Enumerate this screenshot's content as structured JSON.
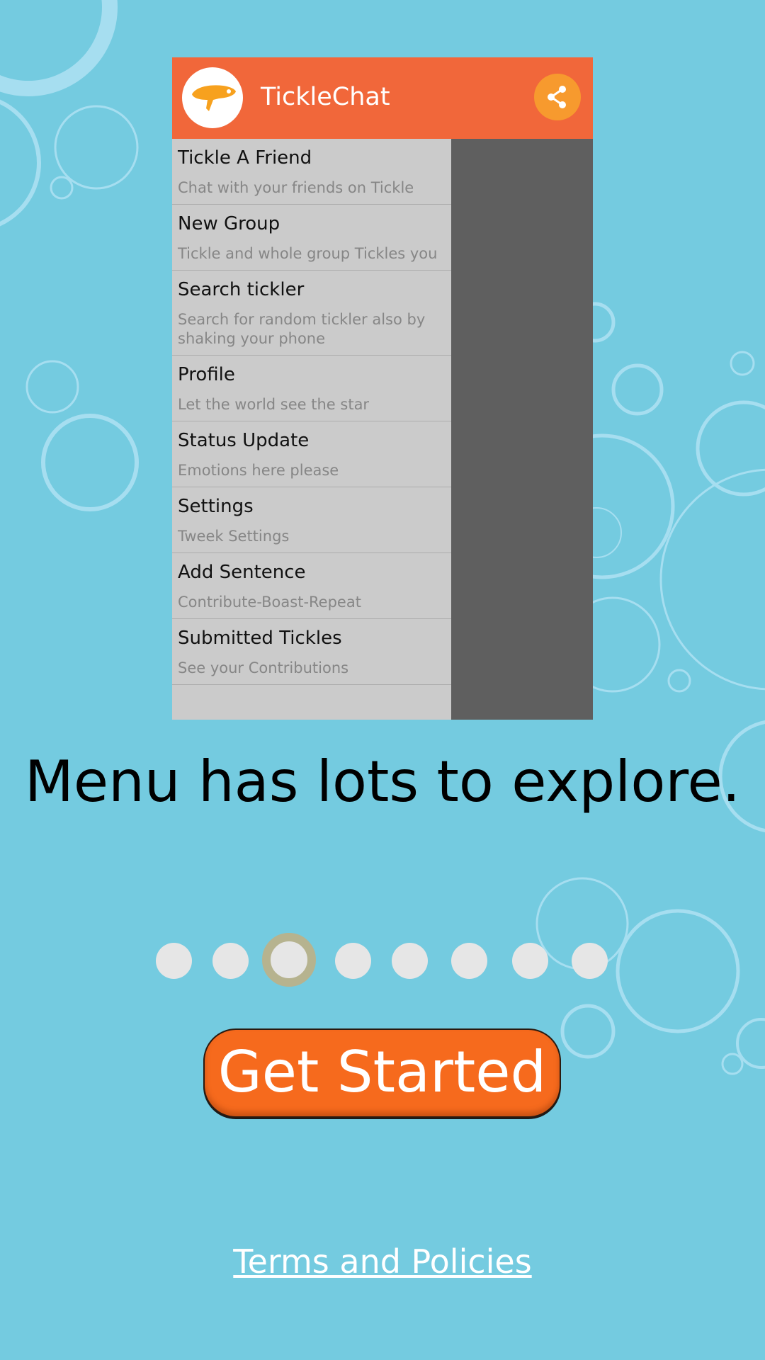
{
  "app": {
    "title": "TickleChat"
  },
  "menu": {
    "items": [
      {
        "title": "Tickle A Friend",
        "subtitle": "Chat with your friends on Tickle"
      },
      {
        "title": "New Group",
        "subtitle": "Tickle and whole group Tickles you"
      },
      {
        "title": "Search tickler",
        "subtitle": "Search for random tickler also by shaking your phone"
      },
      {
        "title": "Profile",
        "subtitle": "Let the world see the star"
      },
      {
        "title": "Status Update",
        "subtitle": "Emotions here please"
      },
      {
        "title": "Settings",
        "subtitle": "Tweek Settings"
      },
      {
        "title": "Add Sentence",
        "subtitle": "Contribute-Boast-Repeat"
      },
      {
        "title": "Submitted Tickles",
        "subtitle": "See your Contributions"
      }
    ]
  },
  "caption": {
    "text": "Menu has lots to explore."
  },
  "pager": {
    "total": 8,
    "current": 3
  },
  "cta": {
    "label": "Get Started"
  },
  "footer": {
    "terms_label": "Terms and Policies"
  },
  "colors": {
    "background": "#74cbe0",
    "header": "#f1673a",
    "button": "#f66a1d",
    "share": "#f79a2e"
  },
  "icons": {
    "logo": "tickle-feather-logo",
    "share": "share-icon"
  }
}
